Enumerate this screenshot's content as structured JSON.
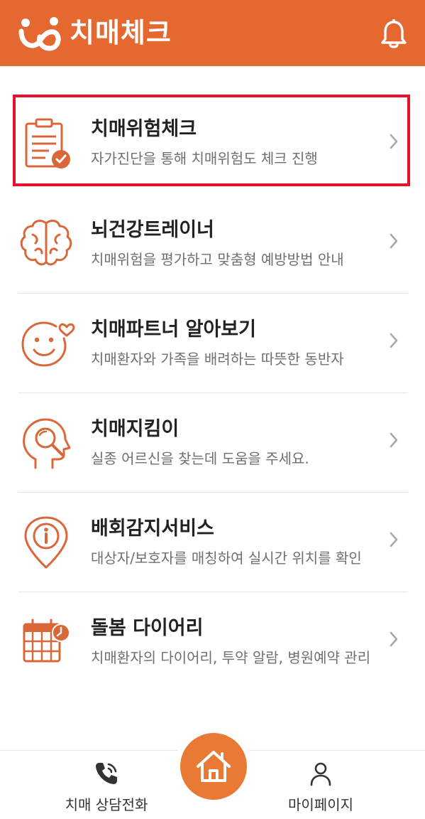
{
  "header": {
    "title": "치매체크",
    "background": "#e4682f",
    "logo_icon": "logo-icon",
    "notification_icon": "bell-icon"
  },
  "menu": [
    {
      "icon": "clipboard-check-icon",
      "title": "치매위험체크",
      "subtitle": "자가진단을 통해 치매위험도 체크 진행",
      "selected": true
    },
    {
      "icon": "brain-icon",
      "title": "뇌건강트레이너",
      "subtitle": "치매위험을 평가하고 맞춤형 예방방법 안내",
      "selected": false
    },
    {
      "icon": "smile-heart-icon",
      "title": "치매파트너 알아보기",
      "subtitle": "치매환자와 가족을 배려하는 따뜻한 동반자",
      "selected": false
    },
    {
      "icon": "head-search-icon",
      "title": "치매지킴이",
      "subtitle": "실종 어르신을 찾는데 도움을 주세요.",
      "selected": false
    },
    {
      "icon": "location-info-icon",
      "title": "배회감지서비스",
      "subtitle": "대상자/보호자를 매칭하여 실시간 위치를 확인",
      "selected": false
    },
    {
      "icon": "calendar-clock-icon",
      "title": "돌봄 다이어리",
      "subtitle": "치매환자의 다이어리, 투약 알람, 병원예약 관리",
      "selected": false
    }
  ],
  "bottom_nav": {
    "call_label": "치매 상담전화",
    "call_icon": "phone-icon",
    "home_icon": "home-icon",
    "mypage_label": "마이페이지",
    "mypage_icon": "person-icon"
  },
  "colors": {
    "accent": "#e4682f",
    "icon": "#d9673a",
    "highlight_border": "#e8102c"
  }
}
